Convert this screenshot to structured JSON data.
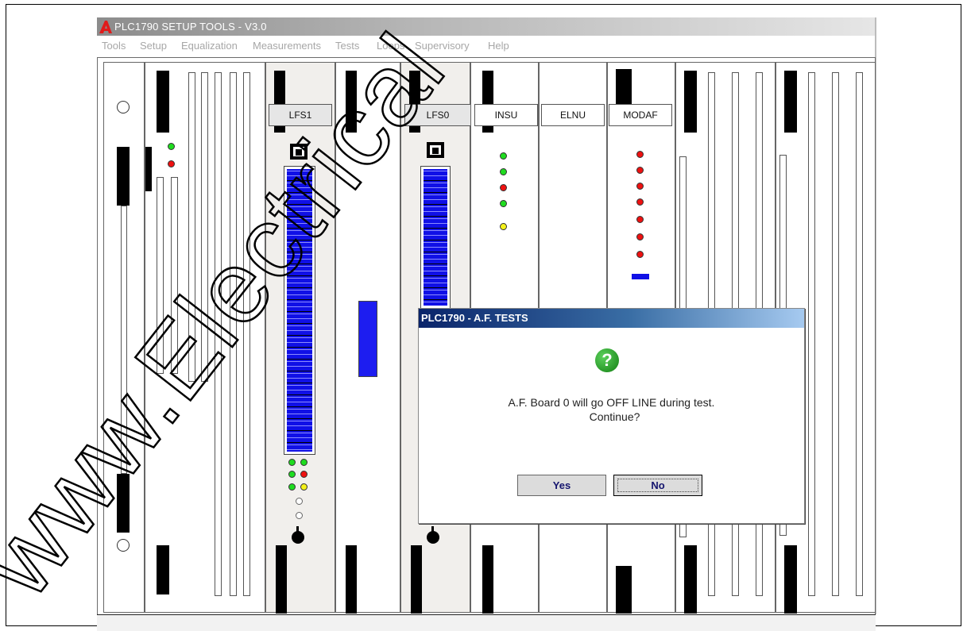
{
  "window": {
    "title": "PLC1790 SETUP TOOLS  -  V3.0",
    "logo_icon": "red-a-logo-icon"
  },
  "menu": [
    "Tools",
    "Setup",
    "Equalization",
    "Measurements",
    "Tests",
    "Loops",
    "Supervisory",
    "Help"
  ],
  "cards": {
    "lfs1": "LFS1",
    "lfs0": "LFS0",
    "insu": "INSU",
    "elnu": "ELNU",
    "modaf": "MODAF"
  },
  "dialog": {
    "title": "PLC1790 - A.F. TESTS",
    "icon": "question-icon",
    "message_line1": "A.F. Board 0 will go OFF LINE during test.",
    "message_line2": "Continue?",
    "yes_label": "Yes",
    "no_label": "No"
  },
  "watermark": {
    "text": "www.Electrical",
    "color": "#000000"
  },
  "colors": {
    "led_green": "#1fdc1f",
    "led_red": "#ee1111",
    "led_yellow": "#f4f11a",
    "meter_blue": "#1010e6"
  }
}
